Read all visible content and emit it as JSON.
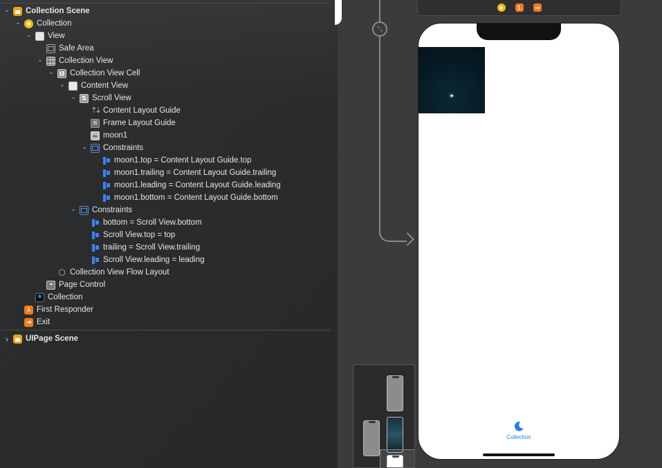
{
  "outline": {
    "rows": [
      {
        "label": "Collection Scene",
        "indent": 0,
        "disc": "open",
        "icon": "scene",
        "bold": true
      },
      {
        "label": "Collection",
        "indent": 1,
        "disc": "open",
        "icon": "vc"
      },
      {
        "label": "View",
        "indent": 2,
        "disc": "open",
        "icon": "view"
      },
      {
        "label": "Safe Area",
        "indent": 3,
        "disc": "none",
        "icon": "safe"
      },
      {
        "label": "Collection View",
        "indent": 3,
        "disc": "open",
        "icon": "grid"
      },
      {
        "label": "Collection View Cell",
        "indent": 4,
        "disc": "open",
        "icon": "cell"
      },
      {
        "label": "Content View",
        "indent": 5,
        "disc": "open",
        "icon": "view"
      },
      {
        "label": "Scroll View",
        "indent": 6,
        "disc": "open",
        "icon": "scroll"
      },
      {
        "label": "Content Layout Guide",
        "indent": 7,
        "disc": "none",
        "icon": "guide"
      },
      {
        "label": "Frame Layout Guide",
        "indent": 7,
        "disc": "none",
        "icon": "frame"
      },
      {
        "label": "moon1",
        "indent": 7,
        "disc": "none",
        "icon": "image"
      },
      {
        "label": "Constraints",
        "indent": 7,
        "disc": "open",
        "icon": "constraints"
      },
      {
        "label": "moon1.top = Content Layout Guide.top",
        "indent": 8,
        "disc": "none",
        "icon": "cst"
      },
      {
        "label": "moon1.trailing = Content Layout Guide.trailing",
        "indent": 8,
        "disc": "none",
        "icon": "cst"
      },
      {
        "label": "moon1.leading = Content Layout Guide.leading",
        "indent": 8,
        "disc": "none",
        "icon": "cst"
      },
      {
        "label": "moon1.bottom = Content Layout Guide.bottom",
        "indent": 8,
        "disc": "none",
        "icon": "cst"
      },
      {
        "label": "Constraints",
        "indent": 6,
        "disc": "open",
        "icon": "constraints"
      },
      {
        "label": "bottom = Scroll View.bottom",
        "indent": 7,
        "disc": "none",
        "icon": "cst"
      },
      {
        "label": "Scroll View.top = top",
        "indent": 7,
        "disc": "none",
        "icon": "cst"
      },
      {
        "label": "trailing = Scroll View.trailing",
        "indent": 7,
        "disc": "none",
        "icon": "cst"
      },
      {
        "label": "Scroll View.leading = leading",
        "indent": 7,
        "disc": "none",
        "icon": "cst"
      },
      {
        "label": "Collection View Flow Layout",
        "indent": 4,
        "disc": "none",
        "icon": "flow"
      },
      {
        "label": "Page Control",
        "indent": 3,
        "disc": "none",
        "icon": "page"
      },
      {
        "label": "Collection",
        "indent": 2,
        "disc": "none",
        "icon": "star"
      },
      {
        "label": "First Responder",
        "indent": 1,
        "disc": "none",
        "icon": "first"
      },
      {
        "label": "Exit",
        "indent": 1,
        "disc": "none",
        "icon": "exit"
      },
      {
        "label": "UIPage Scene",
        "indent": 0,
        "disc": "closed",
        "icon": "scene",
        "bold": true,
        "separator_before": true
      }
    ]
  },
  "canvas": {
    "dock_icons": [
      "view-controller-icon",
      "first-responder-icon",
      "exit-icon"
    ],
    "tab_bar": {
      "label": "Collection",
      "icon": "moon-icon"
    },
    "first_responder_glyph": "1"
  }
}
